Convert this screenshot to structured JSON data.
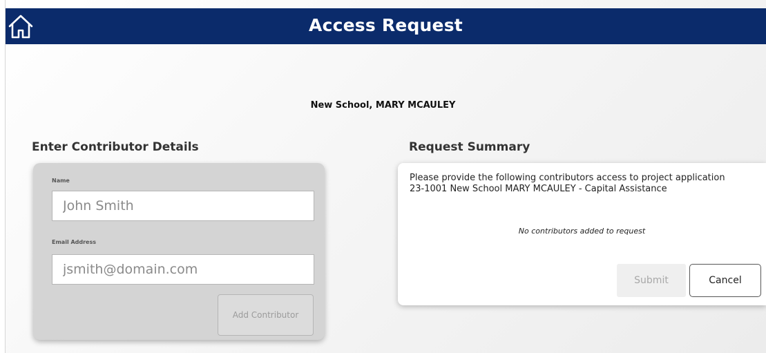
{
  "header": {
    "title": "Access Request",
    "home_icon": "home-icon",
    "background_color": "#0b2b6b"
  },
  "project": {
    "school_line": "New School, MARY MCAULEY"
  },
  "contributor_form": {
    "title": "Enter Contributor Details",
    "name_label": "Name",
    "name_value": "",
    "name_placeholder": "John Smith",
    "email_label": "Email Address",
    "email_value": "",
    "email_placeholder": "jsmith@domain.com",
    "add_button_label": "Add Contributor",
    "add_button_disabled": true
  },
  "summary": {
    "title": "Request Summary",
    "message": "Please provide the following contributors access to project application 23-1001 New School MARY MCAULEY - Capital Assistance",
    "empty_message": "No contributors added to request",
    "submit_label": "Submit",
    "submit_disabled": true,
    "cancel_label": "Cancel"
  }
}
